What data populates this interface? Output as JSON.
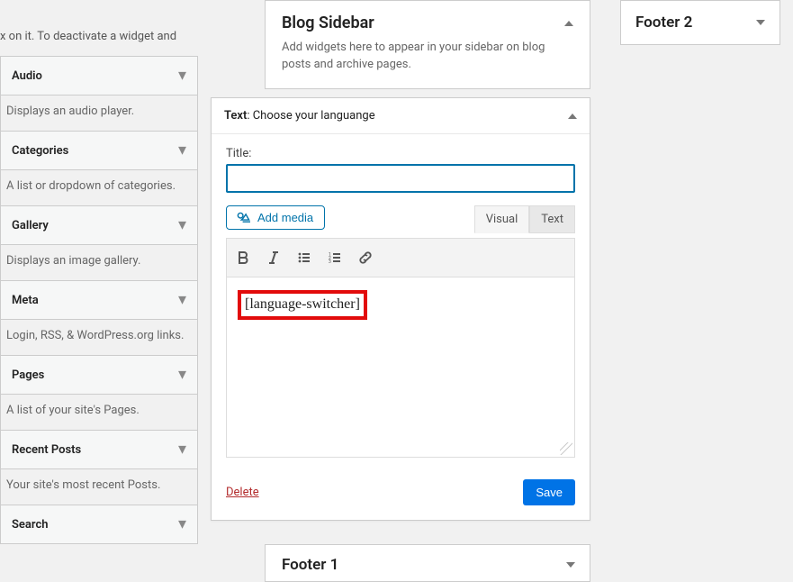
{
  "instructions_tail": "x on it. To deactivate a widget and",
  "available_widgets": [
    {
      "name": "Audio",
      "desc": "Displays an audio player."
    },
    {
      "name": "Categories",
      "desc": "A list or dropdown of categories."
    },
    {
      "name": "Gallery",
      "desc": "Displays an image gallery."
    },
    {
      "name": "Meta",
      "desc": "Login, RSS, & WordPress.org links."
    },
    {
      "name": "Pages",
      "desc": "A list of your site's Pages."
    },
    {
      "name": "Recent Posts",
      "desc": "Your site's most recent Posts."
    },
    {
      "name": "Search",
      "desc": ""
    }
  ],
  "sidebar": {
    "title": "Blog Sidebar",
    "description": "Add widgets here to appear in your sidebar on blog posts and archive pages."
  },
  "widget_editor": {
    "type_label": "Text",
    "separator": ": ",
    "instance_title": "Choose your languange",
    "title_label": "Title:",
    "title_value": "",
    "add_media_label": "Add media",
    "tabs": {
      "visual": "Visual",
      "text": "Text"
    },
    "content_shortcode": "[language-switcher]",
    "delete_label": "Delete",
    "save_label": "Save"
  },
  "footer_areas": {
    "footer1": "Footer 1",
    "footer2": "Footer 2"
  }
}
